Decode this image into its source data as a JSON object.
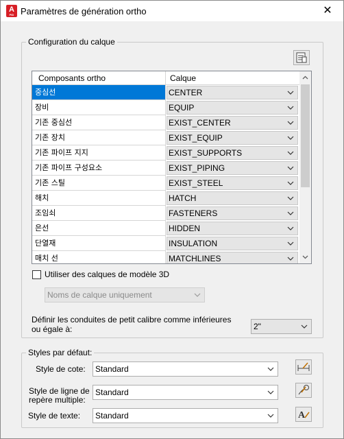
{
  "window": {
    "title": "Paramètres de génération ortho",
    "app_icon_letter": "A",
    "app_icon_sub": "PID",
    "close_glyph": "✕"
  },
  "layer_config": {
    "legend": "Configuration du calque",
    "settings_icon": "layer-list-icon",
    "columns": [
      "Composants ortho",
      "Calque"
    ],
    "rows": [
      {
        "component": "중심선",
        "layer": "CENTER",
        "selected": true
      },
      {
        "component": "장비",
        "layer": "EQUIP"
      },
      {
        "component": "기존 중심선",
        "layer": "EXIST_CENTER"
      },
      {
        "component": "기존 장치",
        "layer": "EXIST_EQUIP"
      },
      {
        "component": "기존 파이프 지지",
        "layer": "EXIST_SUPPORTS"
      },
      {
        "component": "기존 파이프 구성요소",
        "layer": "EXIST_PIPING"
      },
      {
        "component": "기존 스틸",
        "layer": "EXIST_STEEL"
      },
      {
        "component": "해치",
        "layer": "HATCH"
      },
      {
        "component": "조임쇠",
        "layer": "FASTENERS"
      },
      {
        "component": "은선",
        "layer": "HIDDEN"
      },
      {
        "component": "단열재",
        "layer": "INSULATION"
      },
      {
        "component": "매치 선",
        "layer": "MATCHLINES"
      }
    ],
    "use_3d_layers_label": "Utiliser des calques de modèle 3D",
    "use_3d_layers_checked": false,
    "layer_names_option": "Noms de calque uniquement",
    "small_bore_label_1": "Définir les conduites de petit calibre comme inférieures",
    "small_bore_label_2": "ou égale à:",
    "small_bore_value": "2\""
  },
  "default_styles": {
    "legend": "Styles par défaut:",
    "dimension_label": "Style de cote:",
    "dimension_value": "Standard",
    "dimension_icon": "dimension-style-icon",
    "mleader_label_1": "Style de ligne de",
    "mleader_label_2": "repère multiple:",
    "mleader_value": "Standard",
    "mleader_icon": "multileader-style-icon",
    "text_label": "Style de texte:",
    "text_value": "Standard",
    "text_icon": "text-style-icon"
  }
}
